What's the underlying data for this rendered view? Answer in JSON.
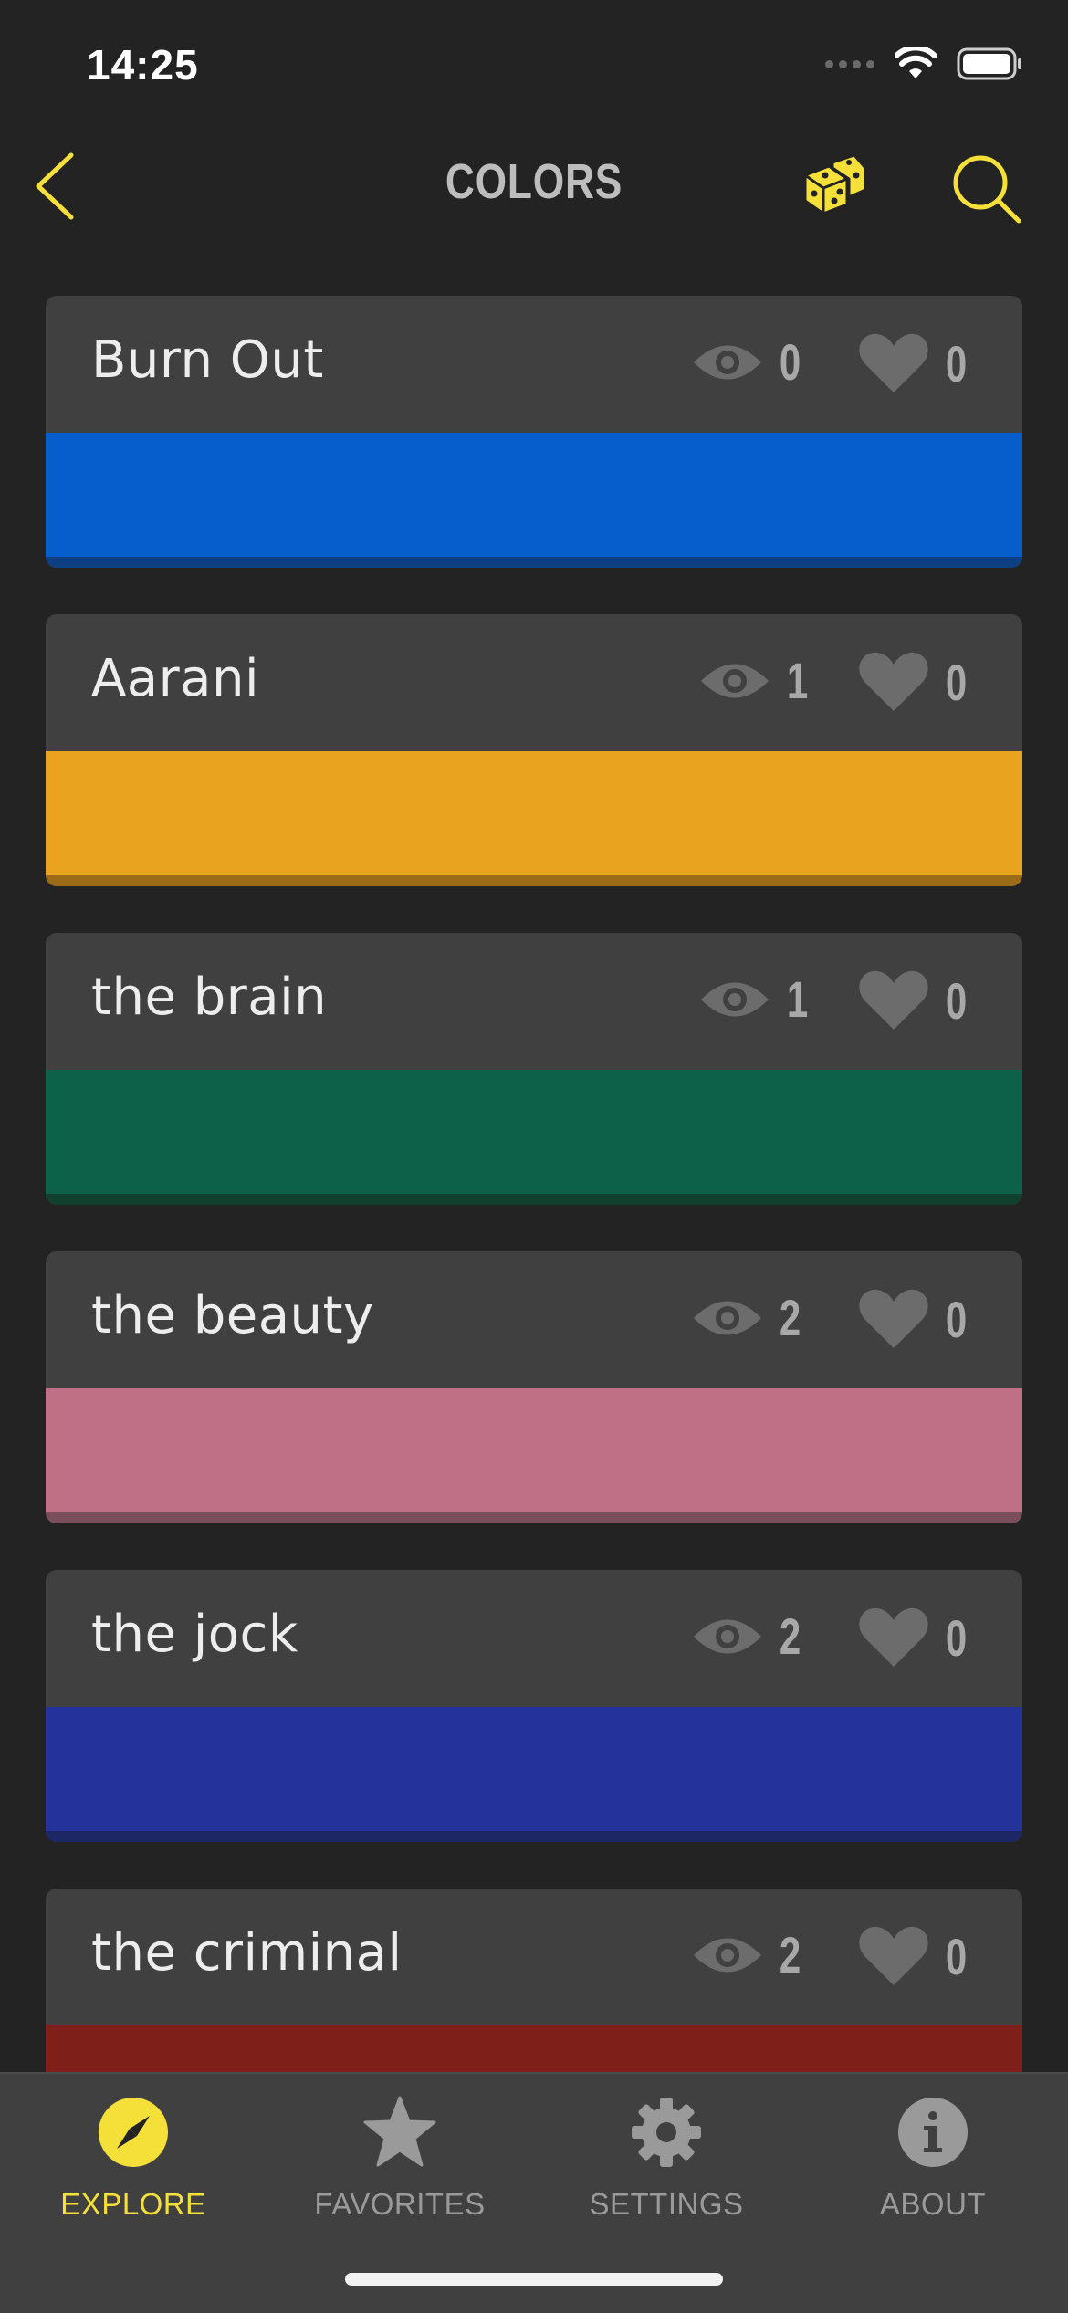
{
  "status_bar": {
    "time": "14:25"
  },
  "nav": {
    "title": "COLORS"
  },
  "colors": [
    {
      "name": "Burn Out",
      "views": "0",
      "likes": "0",
      "swatch": "#055ecb",
      "shade": "#0e3f80"
    },
    {
      "name": "Aarani",
      "views": "1",
      "likes": "0",
      "swatch": "#e9a31e",
      "shade": "#9c6b17"
    },
    {
      "name": "the brain",
      "views": "1",
      "likes": "0",
      "swatch": "#0d6148",
      "shade": "#12402f"
    },
    {
      "name": "the beauty",
      "views": "2",
      "likes": "0",
      "swatch": "#c07086",
      "shade": "#7a4e5a"
    },
    {
      "name": "the jock",
      "views": "2",
      "likes": "0",
      "swatch": "#23339b",
      "shade": "#1e2766"
    },
    {
      "name": "the criminal",
      "views": "2",
      "likes": "0",
      "swatch": "#7e1f1a",
      "shade": "#561a16"
    }
  ],
  "tabs": [
    {
      "label": "EXPLORE",
      "icon": "compass-icon",
      "active": true
    },
    {
      "label": "FAVORITES",
      "icon": "star-icon",
      "active": false
    },
    {
      "label": "SETTINGS",
      "icon": "gear-icon",
      "active": false
    },
    {
      "label": "ABOUT",
      "icon": "info-icon",
      "active": false
    }
  ],
  "theme": {
    "accent": "#f5e03a",
    "background": "#232323",
    "card": "#404040",
    "muted": "#a8a8a8"
  }
}
